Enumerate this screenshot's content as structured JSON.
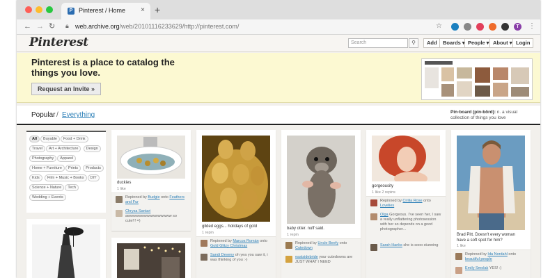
{
  "browser": {
    "tab_title": "Pinterest / Home",
    "close_glyph": "×",
    "new_tab_glyph": "+",
    "url_host": "web.archive.org",
    "url_path": "/web/20101116233629/http://pinterest.com/",
    "profile_initial": "T"
  },
  "header": {
    "logo": "Pinterest",
    "search_placeholder": "Search",
    "nav": [
      "Add",
      "Boards ▾",
      "People ▾",
      "About ▾",
      "Login"
    ]
  },
  "hero": {
    "title": "Pinterest is a place to catalog the things you love.",
    "cta": "Request an Invite »"
  },
  "filter": {
    "popular": "Popular",
    "separator": "/",
    "everything": "Everything",
    "pinboard_term": "Pin·board (pin-bôrd):",
    "pinboard_def": "n. a visual collection of things you love"
  },
  "categories": [
    "All",
    "Buyable",
    "Food + Drink",
    "Travel",
    "Art + Architecture",
    "Design",
    "Photography",
    "Apparel",
    "Home + Furniture",
    "Prints",
    "Products",
    "Kids",
    "Film + Music + Books",
    "DIY",
    "Science + Nature",
    "Tech",
    "Wedding + Events"
  ],
  "pins": [
    {
      "desc": "duckies",
      "meta": "1 like",
      "repins": [
        {
          "a": "Repinned by ",
          "u": "Budgie",
          "b": " onto ",
          "u2": "Feathers and Fur",
          "c": ""
        },
        {
          "a": "",
          "u": "Chrysa Santari",
          "b": " awwwwwwwwwwwwwwww so cute!!! =)",
          "u2": "",
          "c": ""
        }
      ]
    },
    {
      "desc": "gilded eggs... holidays of gold",
      "meta": "1 repin",
      "repins": [
        {
          "a": "Repinned by ",
          "u": "Marcos Román",
          "b": " onto ",
          "u2": "Gold Glitzy Christmas",
          "c": ""
        },
        {
          "a": "",
          "u": "Sandi Deveny",
          "b": " oh yea you saw it, i was thinking of you :-)",
          "u2": "",
          "c": ""
        }
      ]
    },
    {
      "desc": "baby otter. nuff said.",
      "meta": "1 repin",
      "repins": [
        {
          "a": "Repinned by ",
          "u": "Uncle Beefy",
          "b": " onto ",
          "u2": "Cutedown",
          "c": ""
        },
        {
          "a": "",
          "u": "eastsidebride",
          "b": " your cutedowns are JUST WHAT I NEED",
          "u2": "",
          "c": ""
        }
      ]
    },
    {
      "desc": "gorgeousity",
      "meta": "1 like   2 repins",
      "repins": [
        {
          "a": "Repinned by ",
          "u": "Cirilia Rose",
          "b": " onto ",
          "u2": "Lovelies",
          "c": ""
        },
        {
          "a": "",
          "u": "Olga",
          "b": " Gorgeous. I've seen her, I saw a really unflattering photosession with her so depends on a good photographer...",
          "u2": "",
          "c": ""
        },
        {
          "a": "",
          "u": "Sarah Hanks",
          "b": " she is sooo stunning",
          "u2": "",
          "c": ""
        }
      ]
    },
    {
      "desc": "Brad Pitt. Doesn't every woman have a soft spot for him?",
      "meta": "1 like",
      "repins": [
        {
          "a": "Repinned by ",
          "u": "Ida Nordahl",
          "b": " onto ",
          "u2": "beautiful people",
          "c": ""
        },
        {
          "a": "",
          "u": "Emily Smolak",
          "b": " YES! :)",
          "u2": "",
          "c": ""
        }
      ]
    }
  ]
}
